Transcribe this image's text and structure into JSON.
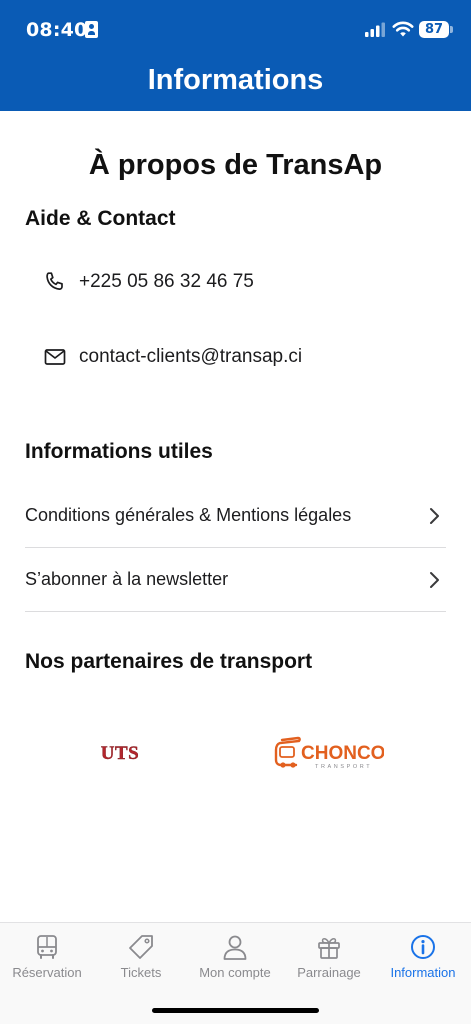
{
  "status_bar": {
    "time": "08:40",
    "battery": "87"
  },
  "header": {
    "title": "Informations"
  },
  "page_title": "À propos de TransAp",
  "help_contact": {
    "title": "Aide & Contact",
    "phone": "+225 05 86 32 46 75",
    "email": "contact-clients@transap.ci"
  },
  "useful_info": {
    "title": "Informations utiles",
    "items": [
      {
        "label": "Conditions générales & Mentions légales"
      },
      {
        "label": "S’abonner à la newsletter"
      }
    ]
  },
  "partners": {
    "title": "Nos partenaires de transport",
    "logos": [
      {
        "name": "UTS",
        "text": "UTS",
        "color": "#b3262d"
      },
      {
        "name": "CHONCO",
        "text": "CHONCO",
        "tagline": "TRANSPORT",
        "color": "#e2601f"
      }
    ]
  },
  "tabbar": {
    "accent_color": "#1a73e8",
    "inactive_color": "#8a8a8e",
    "tabs": [
      {
        "label": "Réservation",
        "icon": "bus-icon",
        "active": false
      },
      {
        "label": "Tickets",
        "icon": "tag-icon",
        "active": false
      },
      {
        "label": "Mon compte",
        "icon": "person-icon",
        "active": false
      },
      {
        "label": "Parrainage",
        "icon": "gift-icon",
        "active": false
      },
      {
        "label": "Information",
        "icon": "info-icon",
        "active": true
      }
    ]
  },
  "colors": {
    "header_bg": "#0a5bb5",
    "divider": "#dcdcde"
  }
}
